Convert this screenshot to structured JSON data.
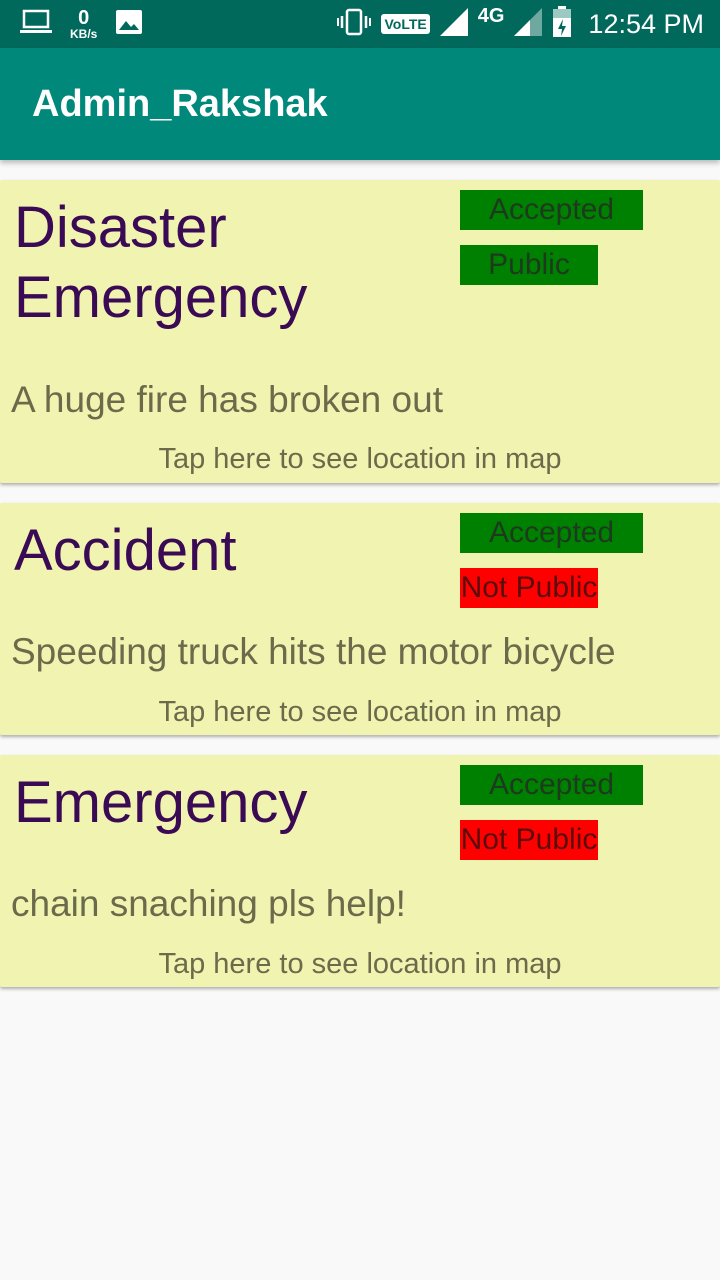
{
  "status_bar": {
    "kb_value": "0",
    "kb_unit": "KB/s",
    "volte": "VoLTE",
    "network": "4G",
    "time": "12:54 PM",
    "icons": [
      "laptop-icon",
      "image-icon",
      "vibrate-icon",
      "signal-icon",
      "battery-icon"
    ]
  },
  "app_bar": {
    "title": "Admin_Rakshak"
  },
  "cards": [
    {
      "title_line1": "Disaster",
      "title_line2": "Emergency",
      "status": "Accepted",
      "visibility": "Public",
      "description": "A huge fire has broken out",
      "link": "Tap here to see location in map"
    },
    {
      "title_line1": "Accident",
      "status": "Accepted",
      "visibility": "Not Public",
      "description": "Speeding truck hits the motor bicycle",
      "link": "Tap here to see location in map"
    },
    {
      "title_line1": "Emergency",
      "status": "Accepted",
      "visibility": "Not Public",
      "description": "chain snaching pls help!",
      "link": "Tap here to see location in map"
    }
  ],
  "colors": {
    "status_bar": "#00695c",
    "app_bar": "#00897b",
    "card_bg": "#f0f4b0",
    "accepted": "#008000",
    "public": "#008000",
    "not_public": "#ff0000",
    "title_text": "#3a0a55"
  }
}
